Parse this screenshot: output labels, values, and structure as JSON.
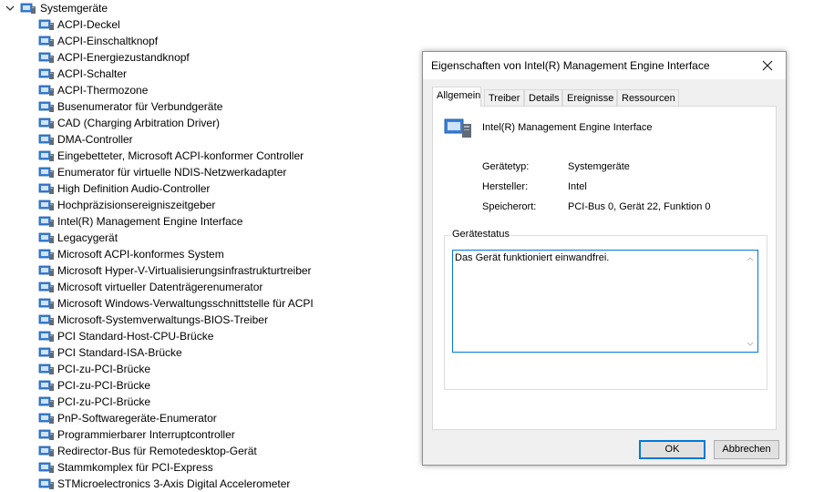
{
  "tree": {
    "category_label": "Systemgeräte",
    "devices": [
      "ACPI-Deckel",
      "ACPI-Einschaltknopf",
      "ACPI-Energiezustandknopf",
      "ACPI-Schalter",
      "ACPI-Thermozone",
      "Busenumerator für Verbundgeräte",
      "CAD (Charging Arbitration Driver)",
      "DMA-Controller",
      "Eingebetteter, Microsoft ACPI-konformer Controller",
      "Enumerator für virtuelle NDIS-Netzwerkadapter",
      "High Definition Audio-Controller",
      "Hochpräzisionsereigniszeitgeber",
      "Intel(R) Management Engine Interface",
      "Legacygerät",
      "Microsoft ACPI-konformes System",
      "Microsoft Hyper-V-Virtualisierungsinfrastrukturtreiber",
      "Microsoft virtueller Datenträgerenumerator",
      "Microsoft Windows-Verwaltungsschnittstelle für ACPI",
      "Microsoft-Systemverwaltungs-BIOS-Treiber",
      "PCI Standard-Host-CPU-Brücke",
      "PCI Standard-ISA-Brücke",
      "PCI-zu-PCI-Brücke",
      "PCI-zu-PCI-Brücke",
      "PCI-zu-PCI-Brücke",
      "PnP-Softwaregeräte-Enumerator",
      "Programmierbarer Interruptcontroller",
      "Redirector-Bus für Remotedesktop-Gerät",
      "Stammkomplex für PCI-Express",
      "STMicroelectronics 3-Axis Digital Accelerometer"
    ]
  },
  "dialog": {
    "title": "Eigenschaften von Intel(R) Management Engine Interface",
    "tabs": [
      "Allgemein",
      "Treiber",
      "Details",
      "Ereignisse",
      "Ressourcen"
    ],
    "active_tab": "Allgemein",
    "device_name": "Intel(R) Management Engine Interface",
    "props": {
      "type_label": "Gerätetyp:",
      "type_value": "Systemgeräte",
      "manufacturer_label": "Hersteller:",
      "manufacturer_value": "Intel",
      "location_label": "Speicherort:",
      "location_value": "PCI-Bus 0, Gerät 22, Funktion 0"
    },
    "status_group_label": "Gerätestatus",
    "status_text": "Das Gerät funktioniert einwandfrei.",
    "ok_label": "OK",
    "cancel_label": "Abbrechen"
  },
  "icons": {
    "category": "system-devices-folder-icon",
    "device": "system-device-icon",
    "close": "close-icon"
  },
  "colors": {
    "accent": "#0078d7",
    "dialog_bg": "#f0f0f0",
    "device_icon_blue": "#3a7fd5"
  }
}
